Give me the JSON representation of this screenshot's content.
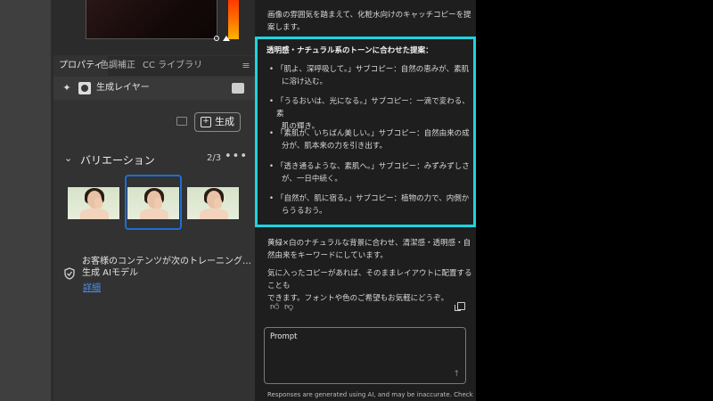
{
  "colors": {
    "highlight_border": "#1cd4e0",
    "selected_thumb_border": "#1f6ed4",
    "link": "#4c8fe8",
    "chat_bg": "#1e1e1e",
    "panel_bg": "#323232"
  },
  "tabs": [
    {
      "label": "プロパティ",
      "active": true
    },
    {
      "label": "色調補正",
      "active": false
    },
    {
      "label": "CC ライブラリ",
      "active": false
    }
  ],
  "tab_menu_icon": "hamburger-icon",
  "layer": {
    "label": "生成レイヤー"
  },
  "generate_button": {
    "label": "生成"
  },
  "variations": {
    "title": "バリエーション",
    "count": "2/3",
    "more": "•••",
    "thumbnails": 3,
    "selected_index": 1
  },
  "training": {
    "text": "お客様のコンテンツが次のトレーニング…生成 AIモデル",
    "line1": "お客様のコンテンツが次のトレーニング…",
    "line2": "生成 AIモデル",
    "link": "詳細"
  },
  "chat": {
    "intro_line1": "画像の雰囲気を踏まえて、化粧水向けのキャッチコピーを提",
    "intro_line2": "案します。",
    "proposal_title": "透明感・ナチュラル系のトーンに合わせた提案：",
    "proposals": [
      {
        "line1": "「肌よ、深呼吸して。」サブコピー：自然の恵みが、素肌",
        "line2": "に溶け込む。"
      },
      {
        "line1": "「うるおいは、光になる。」サブコピー：一滴で変わる、素",
        "line2": "肌の輝き。"
      },
      {
        "line1": "「素肌が、いちばん美しい。」サブコピー：自然由来の成",
        "line2": "分が、肌本来の力を引き出す。"
      },
      {
        "line1": "「透き通るような、素肌へ。」サブコピー：みずみずしさ",
        "line2": "が、一日中続く。"
      },
      {
        "line1": "「自然が、肌に宿る。」サブコピー：植物の力で、内側か",
        "line2": "らうるおう。"
      }
    ],
    "note1_line1": "黄緑×白のナチュラルな背景に合わせ、清潔感・透明感・自",
    "note1_line2": "然由来をキーワードにしています。",
    "note2_line1": "気に入ったコピーがあれば、そのままレイアウトに配置することも",
    "note2_line2": "できます。フォントや色のご希望もお気軽にどうぞ。",
    "prompt_placeholder": "Prompt",
    "disclaimer": "Responses are generated using AI, and may be inaccurate. Check"
  }
}
